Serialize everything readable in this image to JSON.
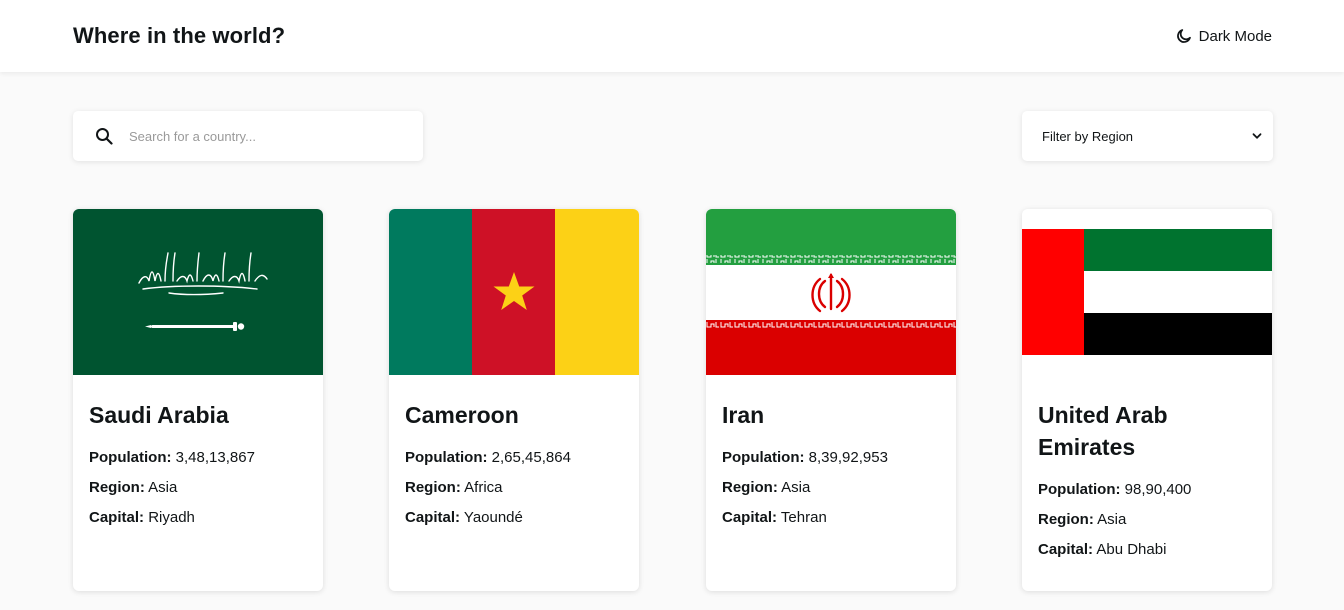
{
  "header": {
    "title": "Where in the world?",
    "dark_mode_label": "Dark Mode",
    "dark_mode_icon": "moon-icon"
  },
  "search": {
    "placeholder": "Search for a country...",
    "value": "",
    "icon": "search-icon"
  },
  "filter": {
    "selected": "Filter by Region",
    "icon": "chevron-down-icon"
  },
  "labels": {
    "population": "Population:",
    "region": "Region:",
    "capital": "Capital:"
  },
  "countries": [
    {
      "name": "Saudi Arabia",
      "population": "3,48,13,867",
      "region": "Asia",
      "capital": "Riyadh"
    },
    {
      "name": "Cameroon",
      "population": "2,65,45,864",
      "region": "Africa",
      "capital": "Yaoundé"
    },
    {
      "name": "Iran",
      "population": "8,39,92,953",
      "region": "Asia",
      "capital": "Tehran"
    },
    {
      "name": "United Arab Emirates",
      "population": "98,90,400",
      "region": "Asia",
      "capital": "Abu Dhabi"
    }
  ],
  "colors": {
    "saudi_green": "#005430",
    "cameroon_green": "#007a5e",
    "cameroon_red": "#ce1126",
    "cameroon_yellow": "#fcd116",
    "iran_green": "#239f40",
    "iran_red": "#da0000",
    "uae_green": "#00732f",
    "uae_red": "#ff0000",
    "uae_black": "#000000"
  }
}
